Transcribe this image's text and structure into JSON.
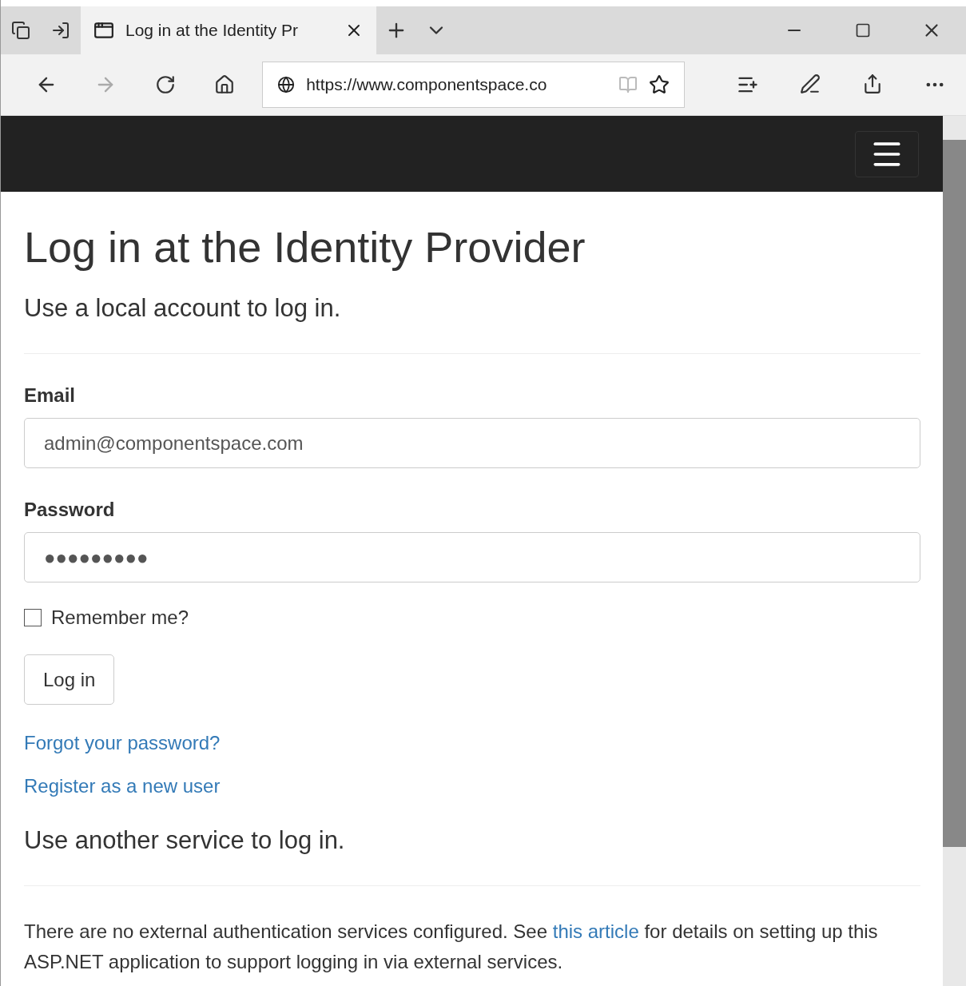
{
  "browser": {
    "tab": {
      "title": "Log in at the Identity Pr",
      "selected": true
    },
    "address": "https://www.componentspace.co",
    "nav": [
      {
        "kind": "back",
        "disabled": false
      },
      {
        "kind": "forward",
        "disabled": true
      },
      {
        "kind": "refresh",
        "disabled": false
      },
      {
        "kind": "home",
        "disabled": false
      }
    ]
  },
  "page": {
    "title": "Log in at the Identity Provider",
    "subtitle": "Use a local account to log in.",
    "fields": [
      {
        "label": "Email",
        "value": "admin@componentspace.com"
      },
      {
        "label": "Password",
        "value": "●●●●●●●●●"
      }
    ],
    "remember": {
      "label": "Remember me?",
      "checked": false
    },
    "submit": "Log in",
    "links": [
      "Forgot your password?",
      "Register as a new user"
    ],
    "external_title": "Use another service to log in.",
    "external_text": {
      "before": "There are no external authentication services configured. See ",
      "link": "this article",
      "after": " for details on setting up this ASP.NET application to support logging in via external services."
    }
  }
}
